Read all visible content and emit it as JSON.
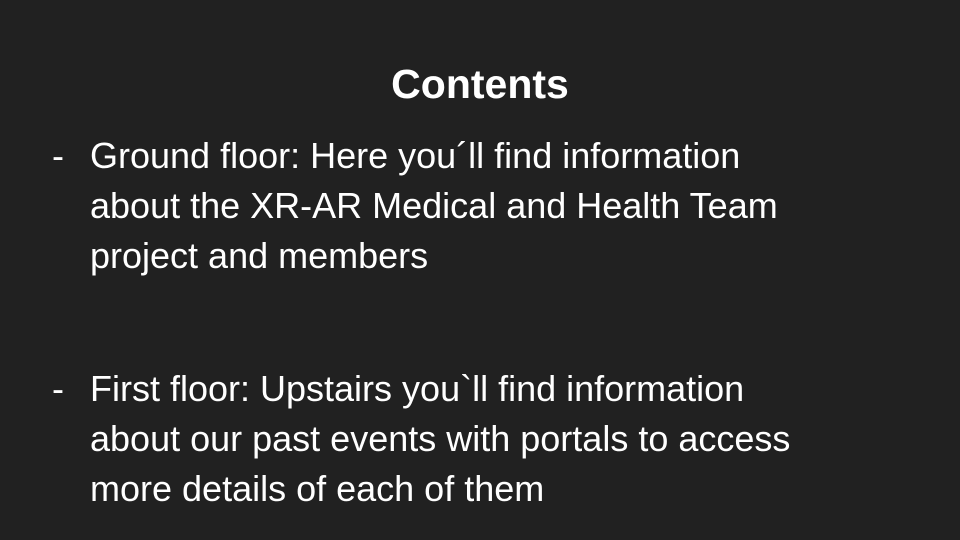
{
  "slide": {
    "title": "Contents",
    "bullets": [
      {
        "marker": "-",
        "lines": [
          "Ground floor: Here you´ll find information",
          "about the XR-AR Medical and Health Team",
          "project and members"
        ]
      },
      {
        "marker": "-",
        "lines": [
          "First floor: Upstairs you`ll find information",
          "about our past events with portals to access",
          "more details of each of them"
        ]
      }
    ]
  },
  "colors": {
    "background": "#212121",
    "text": "#ffffff"
  }
}
